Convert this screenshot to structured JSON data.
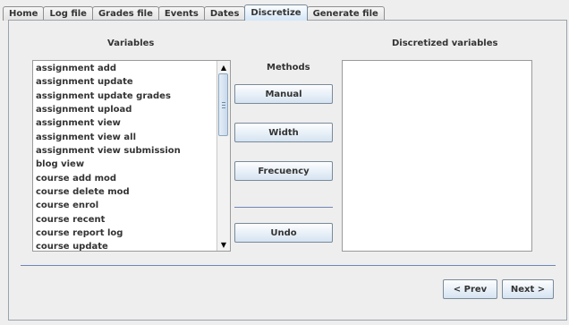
{
  "tabs": [
    {
      "label": "Home"
    },
    {
      "label": "Log file"
    },
    {
      "label": "Grades file"
    },
    {
      "label": "Events"
    },
    {
      "label": "Dates"
    },
    {
      "label": "Discretize"
    },
    {
      "label": "Generate file"
    }
  ],
  "selected_tab": "Discretize",
  "variables": {
    "title": "Variables",
    "items": [
      "assignment add",
      "assignment update",
      "assignment update grades",
      "assignment upload",
      "assignment view",
      "assignment view all",
      "assignment view submission",
      "blog view",
      "course add mod",
      "course delete mod",
      "course enrol",
      "course recent",
      "course report log",
      "course update"
    ]
  },
  "methods": {
    "title": "Methods",
    "manual": "Manual",
    "width": "Width",
    "frequency": "Frecuency",
    "undo": "Undo"
  },
  "discretized": {
    "title": "Discretized variables",
    "items": []
  },
  "nav": {
    "prev": "< Prev",
    "next": "Next >"
  }
}
